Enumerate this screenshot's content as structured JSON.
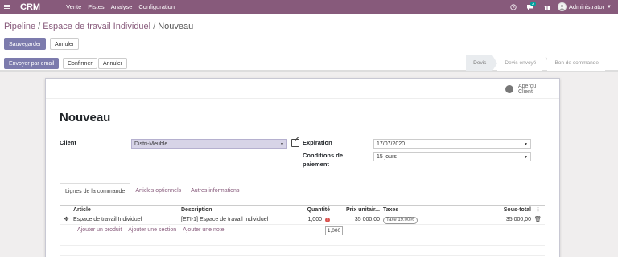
{
  "navbar": {
    "brand": "CRM",
    "menu": [
      "Vente",
      "Pistes",
      "Analyse",
      "Configuration"
    ],
    "message_count": "2",
    "user": "Administrator"
  },
  "breadcrumb": {
    "item1": "Pipeline",
    "item2": "Espace de travail Individuel",
    "current": "Nouveau",
    "sep": "/"
  },
  "buttons": {
    "save": "Sauvegarder",
    "discard": "Annuler",
    "email": "Envoyer par email",
    "confirm": "Confirmer",
    "cancel": "Annuler"
  },
  "status_steps": [
    "Devis",
    "Devis envoyé",
    "Bon de commande"
  ],
  "preview": {
    "line1": "Aperçu",
    "line2": "Client"
  },
  "form": {
    "title": "Nouveau",
    "client_label": "Client",
    "client_value": "Distri-Meuble",
    "expiration_label": "Expiration",
    "expiration_value": "17/07/2020",
    "conditions_label_1": "Conditions de",
    "conditions_label_2": "paiement",
    "conditions_value": "15 jours"
  },
  "tabs": [
    "Lignes de la commande",
    "Articles optionnels",
    "Autres informations"
  ],
  "table": {
    "headers": [
      "Article",
      "Description",
      "Quantité",
      "Prix unitair...",
      "Taxes",
      "Sous-total"
    ],
    "row": {
      "article": "Espace de travail Individuel",
      "description": "[ETI-1] Espace de travail Individuel",
      "quantity": "1,000",
      "price": "35 000,00",
      "tax": "Taxe 19.00%",
      "subtotal": "35 000,00"
    },
    "add_links": [
      "Ajouter un produit",
      "Ajouter une section",
      "Ajouter une note"
    ],
    "tooltip": "1,000"
  }
}
